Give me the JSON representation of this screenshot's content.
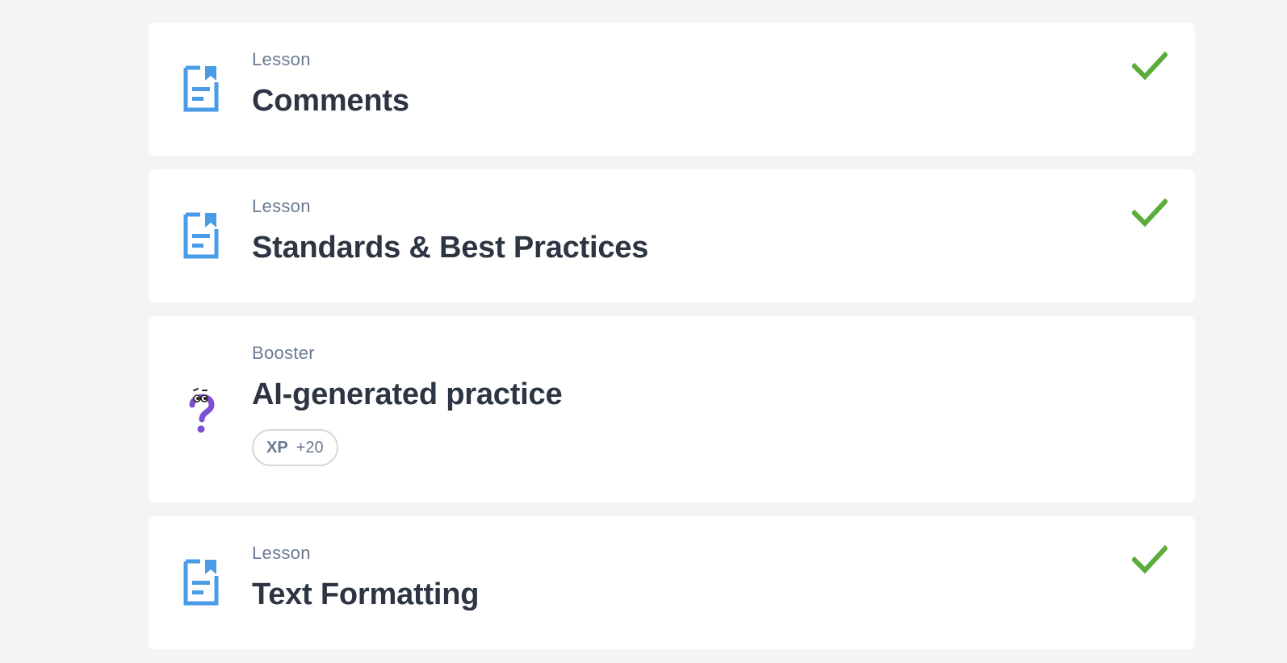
{
  "items": [
    {
      "kind": "Lesson",
      "title": "Comments",
      "icon": "lesson-doc-icon",
      "completed": true
    },
    {
      "kind": "Lesson",
      "title": "Standards & Best Practices",
      "icon": "lesson-doc-icon",
      "completed": true
    },
    {
      "kind": "Booster",
      "title": "AI-generated practice",
      "icon": "question-mark-character-icon",
      "completed": false,
      "xp": {
        "label": "XP",
        "value": "+20"
      }
    },
    {
      "kind": "Lesson",
      "title": "Text Formatting",
      "icon": "lesson-doc-icon",
      "completed": true
    }
  ],
  "colors": {
    "page_bg": "#f3f4f6",
    "card_bg": "#ffffff",
    "lesson_icon": "#4a9be8",
    "booster_icon": "#7c4fd1",
    "check": "#5aad3b",
    "title": "#2d3442",
    "kind": "#6b7a90"
  }
}
